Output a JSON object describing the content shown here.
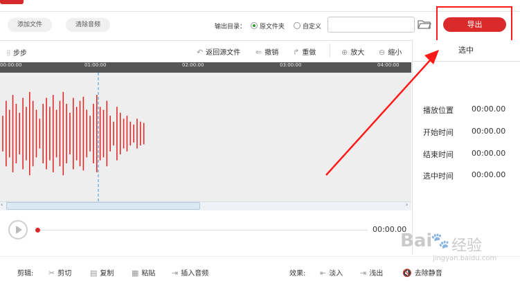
{
  "toolbar": {
    "add_file": "添加文件",
    "clear_audio": "清除音频",
    "output_dir_label": "输出目录：",
    "option_original": "原文件夹",
    "option_custom": "自定义",
    "output_path_value": "",
    "export_label": "导出"
  },
  "edit_toolbar": {
    "step": "步步",
    "back_to_source": "返回源文件",
    "undo": "撤销",
    "redo": "重做",
    "zoom_in": "放大",
    "zoom_out": "缩小"
  },
  "ruler": [
    "00:00:00",
    "01:00:00",
    "02:00:00",
    "03:00:00",
    "04:00:00"
  ],
  "waveform": {
    "color": "#e02a2a",
    "cursor_color": "#5aa9e6",
    "bars": [
      0.3,
      0.55,
      0.4,
      0.65,
      0.5,
      0.35,
      0.6,
      0.45,
      0.7,
      0.55,
      0.4,
      0.25,
      0.5,
      0.6,
      0.45,
      0.65,
      0.4,
      0.55,
      0.7,
      0.5,
      0.35,
      0.6,
      0.45,
      0.55,
      0.62,
      0.4,
      0.3,
      0.5,
      0.65,
      0.45,
      0.4,
      0.55,
      0.3,
      0.2,
      0.45,
      0.35,
      0.25,
      0.3,
      0.2,
      0.15,
      0.25,
      0.2,
      0.18
    ]
  },
  "side_panel": {
    "title": "选中",
    "rows": [
      {
        "label": "播放位置",
        "value": "00:00.00"
      },
      {
        "label": "开始时间",
        "value": "00:00.00"
      },
      {
        "label": "结束时间",
        "value": "00:00.00"
      },
      {
        "label": "选中时间",
        "value": "00:00.00"
      }
    ]
  },
  "player": {
    "time": "00:00.00"
  },
  "bottom": {
    "edit_label": "剪辑:",
    "cut": "剪切",
    "copy": "复制",
    "paste": "粘贴",
    "insert_audio": "插入音频",
    "effect_label": "效果:",
    "fade_in": "淡入",
    "fade_out": "浅出",
    "remove_silence": "去除静音"
  },
  "watermark": {
    "brand": "Bai",
    "brand2": "经验",
    "url": "jingyan.baidu.com"
  },
  "accent": "#db2a2a",
  "icons": [
    "play-icon",
    "folder-icon",
    "undo-icon",
    "redo-icon",
    "zoom-in-icon",
    "zoom-out-icon",
    "cut-icon",
    "copy-icon",
    "paste-icon",
    "insert-audio-icon",
    "fade-in-icon",
    "fade-out-icon",
    "mute-icon"
  ]
}
